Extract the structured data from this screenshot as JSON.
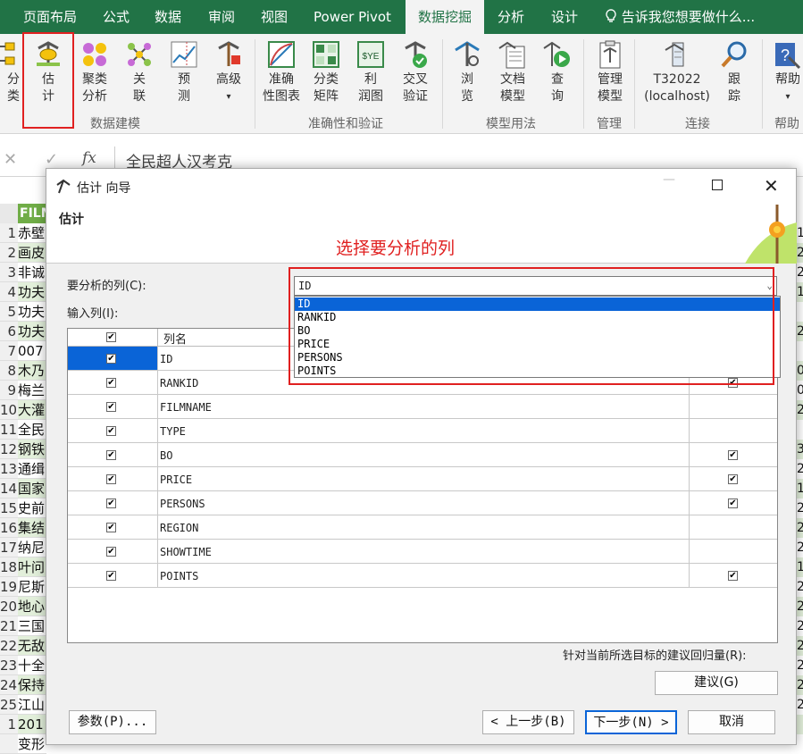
{
  "menubar": {
    "tabs": [
      "页面布局",
      "公式",
      "数据",
      "审阅",
      "视图",
      "Power Pivot",
      "数据挖掘",
      "分析",
      "设计"
    ],
    "active_index": 6,
    "tell_me": "告诉我您想要做什么..."
  },
  "ribbon": {
    "buttons": [
      {
        "l1": "分",
        "l2": "类",
        "icon": "classify-icon"
      },
      {
        "l1": "估",
        "l2": "计",
        "icon": "estimate-icon"
      },
      {
        "l1": "聚类",
        "l2": "分析",
        "icon": "cluster-icon"
      },
      {
        "l1": "关",
        "l2": "联",
        "icon": "associate-icon"
      },
      {
        "l1": "预",
        "l2": "测",
        "icon": "forecast-icon"
      },
      {
        "l1": "高级",
        "l2": "▾",
        "icon": "advanced-icon"
      },
      {
        "l1": "准确",
        "l2": "性图表",
        "icon": "accuracy-chart-icon"
      },
      {
        "l1": "分类",
        "l2": "矩阵",
        "icon": "classification-matrix-icon"
      },
      {
        "l1": "利",
        "l2": "润图",
        "icon": "profit-chart-icon"
      },
      {
        "l1": "交叉",
        "l2": "验证",
        "icon": "cross-validation-icon"
      },
      {
        "l1": "浏",
        "l2": "览",
        "icon": "browse-icon"
      },
      {
        "l1": "文档",
        "l2": "模型",
        "icon": "document-model-icon"
      },
      {
        "l1": "查",
        "l2": "询",
        "icon": "query-icon"
      },
      {
        "l1": "管理",
        "l2": "模型",
        "icon": "manage-models-icon"
      },
      {
        "l1": "T32022",
        "l2": "(localhost)",
        "icon": "server-connection-icon"
      },
      {
        "l1": "跟",
        "l2": "踪",
        "icon": "trace-icon"
      },
      {
        "l1": "帮助",
        "l2": "▾",
        "icon": "help-icon"
      }
    ],
    "groups": [
      "数据建模",
      "准确性和验证",
      "模型用法",
      "管理",
      "连接",
      "帮助"
    ]
  },
  "formula_bar": {
    "fx": "fx",
    "value": "全民超人汉考克"
  },
  "sheet": {
    "header_cell": "FILM",
    "rows": [
      {
        "n": "1",
        "t": "赤壁"
      },
      {
        "n": "2",
        "t": "画皮"
      },
      {
        "n": "3",
        "t": "非诚"
      },
      {
        "n": "4",
        "t": "功夫"
      },
      {
        "n": "5",
        "t": "功夫"
      },
      {
        "n": "6",
        "t": "功夫"
      },
      {
        "n": "7",
        "t": "007"
      },
      {
        "n": "8",
        "t": "木乃"
      },
      {
        "n": "9",
        "t": "梅兰"
      },
      {
        "n": "10",
        "t": "大灌"
      },
      {
        "n": "11",
        "t": "全民"
      },
      {
        "n": "12",
        "t": "钢铁"
      },
      {
        "n": "13",
        "t": "通缉"
      },
      {
        "n": "14",
        "t": "国家"
      },
      {
        "n": "15",
        "t": "史前"
      },
      {
        "n": "16",
        "t": "集结"
      },
      {
        "n": "17",
        "t": "纳尼"
      },
      {
        "n": "18",
        "t": "叶问"
      },
      {
        "n": "19",
        "t": "尼斯"
      },
      {
        "n": "20",
        "t": "地心"
      },
      {
        "n": "21",
        "t": "三国"
      },
      {
        "n": "22",
        "t": "无敌"
      },
      {
        "n": "23",
        "t": "十全"
      },
      {
        "n": "24",
        "t": "保持"
      },
      {
        "n": "25",
        "t": "江山"
      },
      {
        "n": "1",
        "t": "201"
      },
      {
        "n": "",
        "t": "变形"
      }
    ],
    "right_edge": [
      "1",
      "2",
      "2",
      "1",
      "",
      "2",
      "",
      "0",
      "0",
      "2",
      "",
      "3",
      "2",
      "1",
      "2",
      "2",
      "2",
      "1",
      "2",
      "2",
      "2",
      "2",
      "2",
      "2",
      "2",
      "",
      ""
    ]
  },
  "dialog": {
    "title": "估计 向导",
    "header": "估计",
    "annotation": "选择要分析的列",
    "analyze_label": "要分析的列(C):",
    "analyze_value": "ID",
    "input_label": "输入列(I):",
    "col_header": "列名",
    "columns": [
      {
        "name": "ID",
        "checked": true,
        "suggest": false
      },
      {
        "name": "RANKID",
        "checked": true,
        "suggest": true
      },
      {
        "name": "FILMNAME",
        "checked": true,
        "suggest": false
      },
      {
        "name": "TYPE",
        "checked": true,
        "suggest": false
      },
      {
        "name": "BO",
        "checked": true,
        "suggest": true
      },
      {
        "name": "PRICE",
        "checked": true,
        "suggest": true
      },
      {
        "name": "PERSONS",
        "checked": true,
        "suggest": true
      },
      {
        "name": "REGION",
        "checked": true,
        "suggest": false
      },
      {
        "name": "SHOWTIME",
        "checked": true,
        "suggest": false
      },
      {
        "name": "POINTS",
        "checked": true,
        "suggest": true
      }
    ],
    "dropdown_options": [
      "ID",
      "RANKID",
      "BO",
      "PRICE",
      "PERSONS",
      "POINTS"
    ],
    "suggest_note": "针对当前所选目标的建议回归量(R):",
    "suggest_button": "建议(G)",
    "params_button": "参数(P)...",
    "back_button": "< 上一步(B)",
    "next_button": "下一步(N) >",
    "cancel_button": "取消"
  },
  "colors": {
    "excel_green": "#217346",
    "highlight": "#e02020",
    "selection": "#0a64d7"
  }
}
